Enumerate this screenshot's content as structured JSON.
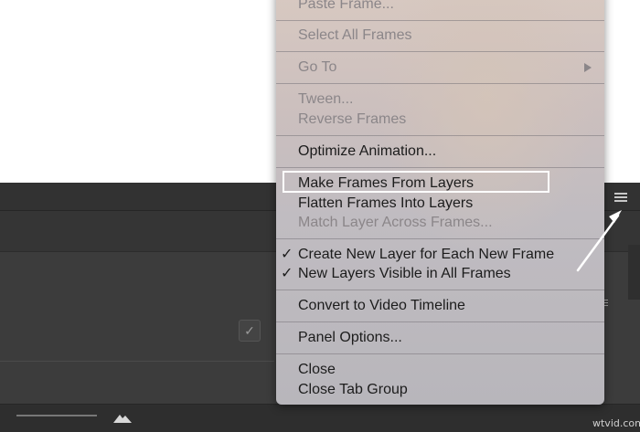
{
  "menu": {
    "items": {
      "paste_frame": "Paste Frame...",
      "select_all_frames": "Select All Frames",
      "go_to": "Go To",
      "tween": "Tween...",
      "reverse_frames": "Reverse Frames",
      "optimize_animation": "Optimize Animation...",
      "make_frames_from_layers": "Make Frames From Layers",
      "flatten_frames_into_layers": "Flatten Frames Into Layers",
      "match_layer_across_frames": "Match Layer Across Frames...",
      "create_new_layer": "Create New Layer for Each New Frame",
      "new_layers_visible": "New Layers Visible in All Frames",
      "convert_to_video_timeline": "Convert to Video Timeline",
      "panel_options": "Panel Options...",
      "close": "Close",
      "close_tab_group": "Close Tab Group"
    },
    "check_glyph": "✓",
    "highlighted_item": "Make Frames From Layers"
  },
  "panel": {
    "menu_icon": "hamburger-icon",
    "checkbox_glyph": "✓"
  },
  "watermark": "wtvid.com",
  "colors": {
    "panel_bg": "#3a3a3a",
    "menu_bg": "#cbbfbe",
    "highlight_border": "#ffffff",
    "disabled_text": "#8b8689"
  }
}
